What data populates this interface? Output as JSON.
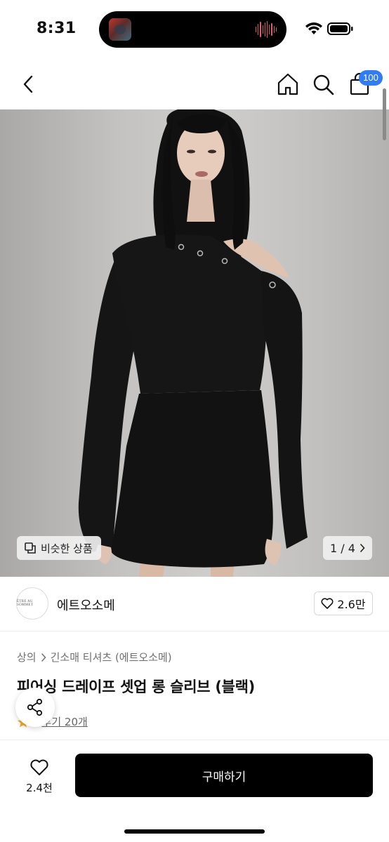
{
  "status_bar": {
    "time": "8:31"
  },
  "header": {
    "cart_badge": "100"
  },
  "gallery": {
    "similar_label": "비슷한 상품",
    "page_current": "1",
    "page_total": "4"
  },
  "brand": {
    "logo_text": "ÉTRE AU SOMMET",
    "name": "에트오소메",
    "likes": "2.6만"
  },
  "product": {
    "category": "상의",
    "subcategory": "긴소매 티셔츠 (에트오소메)",
    "title": "피어싱 드레이프 셋업 롱 슬리브 (블랙)",
    "rating": "5",
    "review_label": "후기 20개"
  },
  "bottom_bar": {
    "wish_count": "2.4천",
    "buy_label": "구매하기"
  },
  "colors": {
    "accent_badge": "#2f7cf6",
    "buy_button": "#000000",
    "star": "#f5a623"
  }
}
